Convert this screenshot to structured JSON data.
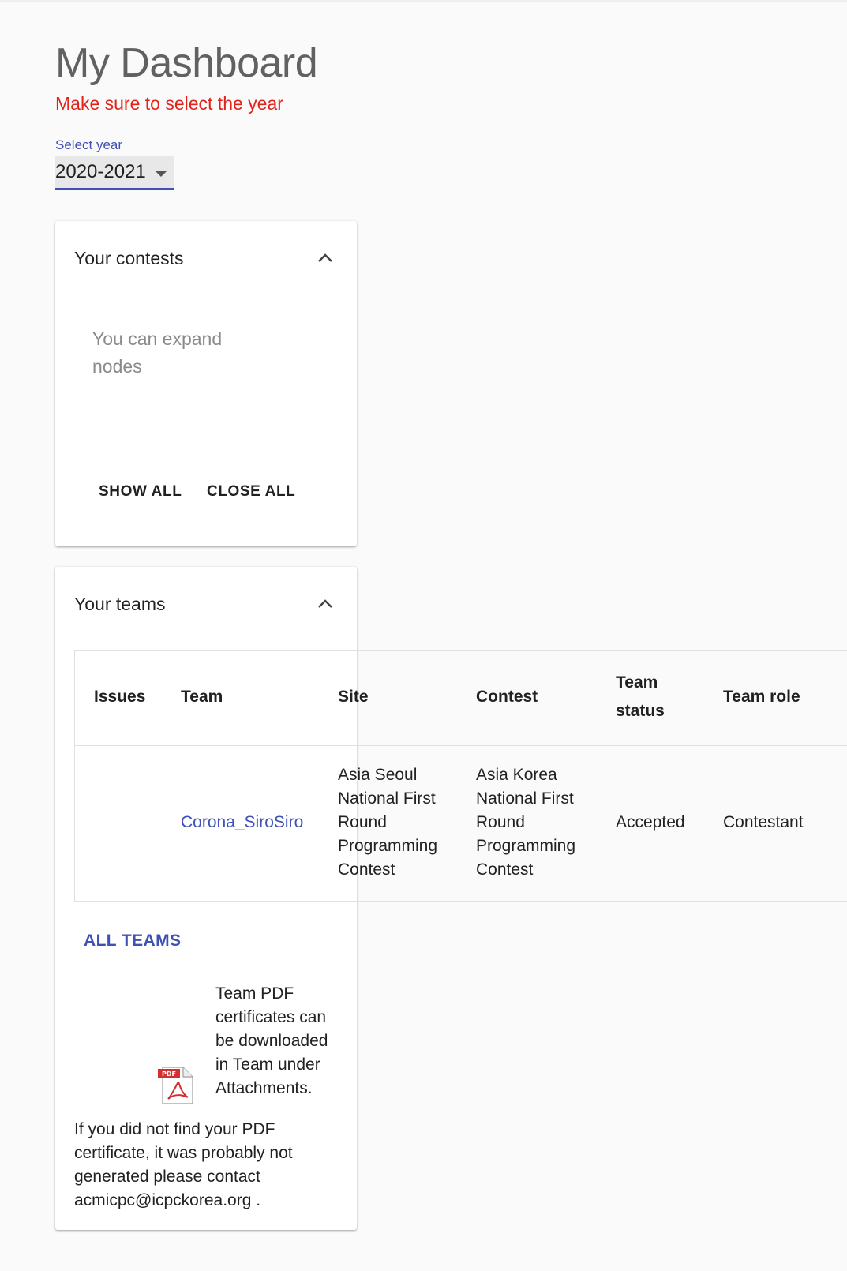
{
  "page": {
    "title": "My Dashboard",
    "warning": "Make sure to select the year"
  },
  "year_select": {
    "label": "Select year",
    "value": "2020-2021"
  },
  "contests_card": {
    "title": "Your contests",
    "hint": "You can expand nodes",
    "show_all": "SHOW ALL",
    "close_all": "CLOSE ALL"
  },
  "teams_card": {
    "title": "Your teams",
    "columns": {
      "issues": "Issues",
      "team": "Team",
      "site": "Site",
      "contest": "Contest",
      "status": "Team status",
      "role": "Team role"
    },
    "rows": [
      {
        "issues": "",
        "team": "Corona_SiroSiro",
        "site": "Asia Seoul National First Round Programming Contest",
        "contest": "Asia Korea National First Round Programming Contest",
        "status": "Accepted",
        "role": "Contestant"
      }
    ],
    "all_teams": "ALL TEAMS",
    "pdf_note": "Team PDF certificates can be downloaded in Team under Attachments.",
    "pdf_badge": "PDF",
    "footnote": "If you did not find your PDF certificate, it was probably not generated please contact acmicpc@icpckorea.org ."
  },
  "colors": {
    "accent": "#3f51b5",
    "warning": "#e2231a",
    "pdf_red": "#d32f2f"
  },
  "icons": {
    "collapse": "chevron-up-icon",
    "dropdown": "caret-down-icon",
    "pdf": "pdf-file-icon"
  }
}
